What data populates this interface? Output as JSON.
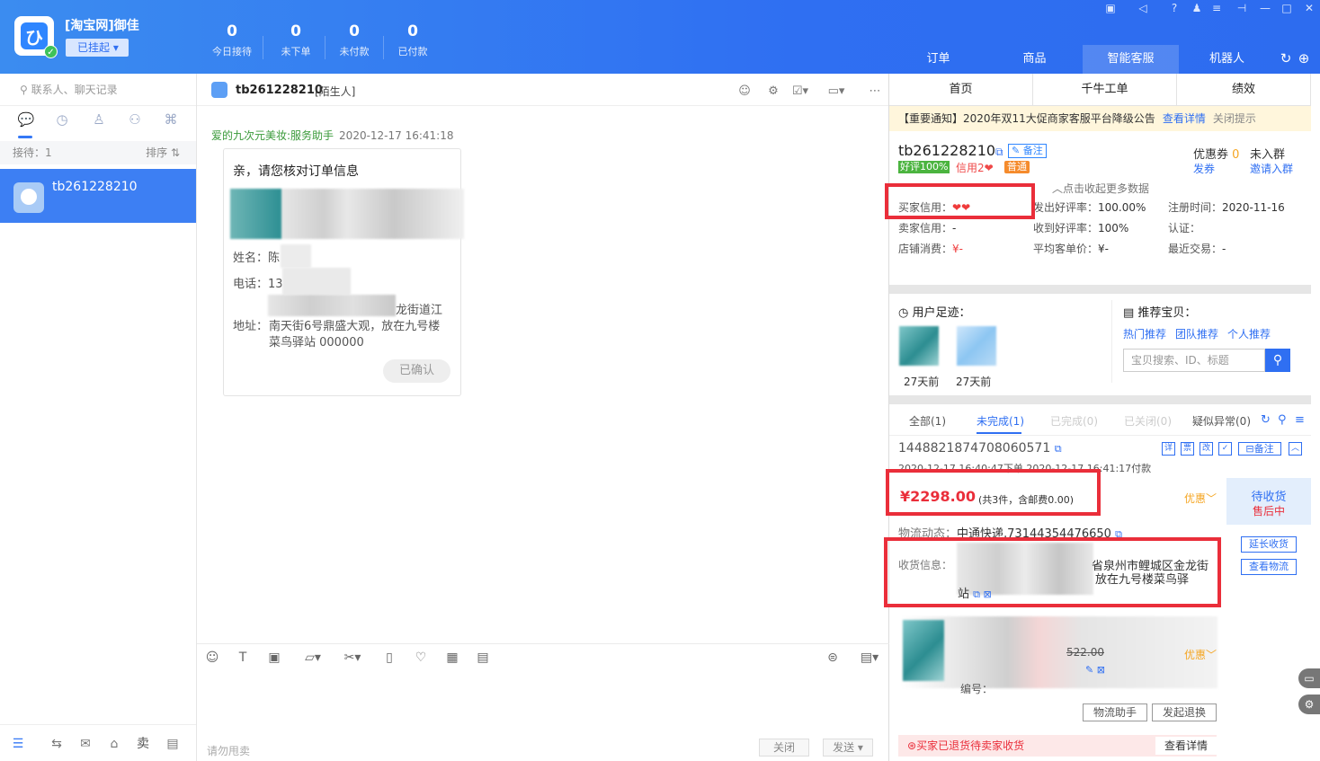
{
  "app": {
    "account_name": "[淘宝网]御佳",
    "status_label": "已挂起",
    "stats": [
      {
        "value": "0",
        "label": "今日接待"
      },
      {
        "value": "0",
        "label": "未下单"
      },
      {
        "value": "0",
        "label": "未付款"
      },
      {
        "value": "0",
        "label": "已付款"
      }
    ],
    "main_tabs": [
      "订单",
      "商品",
      "智能客服",
      "机器人"
    ],
    "active_tab": "智能客服"
  },
  "left": {
    "search_placeholder": "联系人、聊天记录",
    "receiving_label": "接待：1",
    "sort_label": "排序 ⇅",
    "contact_name": "tb261228210"
  },
  "chat": {
    "title": "tb261228210",
    "tag": "[陌生人]",
    "message": {
      "sender": "爱的九次元美妆:服务助手",
      "time": "2020-12-17 16:41:18",
      "heading": "亲，请您核对订单信息",
      "name_label": "姓名：",
      "name_value": "陈",
      "phone_label": "电话：",
      "phone_value": "13",
      "address_label": "地址：",
      "address_line1": "龙街道江",
      "address_line2": "南天街6号鼎盛大观，放在九号楼",
      "address_line3": "菜鸟驿站 000000",
      "confirm_label": "已确认"
    },
    "input_placeholder": "请勿甩卖",
    "close_label": "关闭",
    "send_label": "发送 ▾"
  },
  "right": {
    "sub_tabs": [
      "首页",
      "千牛工单",
      "绩效"
    ],
    "notice_text": "【重要通知】2020年双11大促商家客服平台降级公告",
    "notice_link": "查看详情",
    "notice_close": "关闭提示",
    "buyer_id": "tb261228210",
    "note_tag": "备注",
    "good_rate_tag": "好评100%",
    "credit_tag": "信用2❤",
    "normal_tag": "普通",
    "coupon_label": "优惠券",
    "coupon_count": "0",
    "coupon_send": "发券",
    "group_label": "未入群",
    "group_invite": "邀请入群",
    "collapse_label": "点击收起更多数据",
    "kv": [
      {
        "label": "买家信用：",
        "value": "❤❤"
      },
      {
        "label": "发出好评率：",
        "value": "100.00%"
      },
      {
        "label": "注册时间：",
        "value": "2020-11-16"
      },
      {
        "label": "卖家信用：",
        "value": "-"
      },
      {
        "label": "收到好评率：",
        "value": "100%"
      },
      {
        "label": "认证：",
        "value": ""
      },
      {
        "label": "店铺消费：",
        "value": "¥-"
      },
      {
        "label": "平均客单价：",
        "value": "¥-"
      },
      {
        "label": "最近交易：",
        "value": "-"
      }
    ],
    "footprint_title": "用户足迹：",
    "footprint_items": [
      "27天前",
      "27天前"
    ],
    "recommend_title": "推荐宝贝：",
    "recommend_links": [
      "热门推荐",
      "团队推荐",
      "个人推荐"
    ],
    "recommend_search_placeholder": "宝贝搜索、ID、标题",
    "order_tabs": [
      "全部(1)",
      "未完成(1)",
      "已完成(0)",
      "已关闭(0)",
      "疑似异常(0)"
    ],
    "order": {
      "id": "1448821874708060571",
      "icons": [
        "详",
        "票",
        "改",
        "备注"
      ],
      "time": "2020-12-17 16:40:47下单 2020-12-17 16:41:17付款",
      "price": "¥2298.00",
      "price_sub": "(共3件，含邮费0.00)",
      "discount": "优惠",
      "status": "待收货",
      "status_sub": "售后中",
      "logistics_label": "物流动态：",
      "logistics_value": "中通快递,73144354476650",
      "extend_btn": "延长收货",
      "track_btn": "查看物流",
      "recv_label": "收货信息：",
      "recv_line1": "省泉州市鲤城区金龙街",
      "recv_line2": "放在九号楼菜鸟驿",
      "recv_line3": "站",
      "item_price": "522.00",
      "item_discount": "优惠",
      "item_code_label": "编号：",
      "logistics_helper": "物流助手",
      "return_btn": "发起退换",
      "alert": "买家已退货待卖家收货",
      "alert_link": "查看详情"
    }
  },
  "colors": {
    "accent": "#2f6ff2",
    "alert": "#ea2e3a",
    "highlight_box": "#ea2e3a"
  }
}
